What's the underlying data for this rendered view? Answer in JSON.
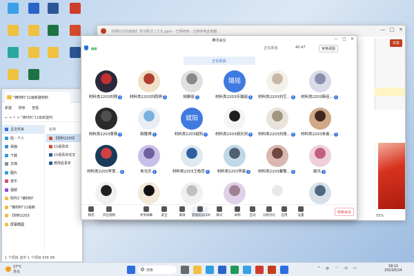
{
  "desktop": {
    "icons": [
      {
        "label": "",
        "color": "#3aa0e8"
      },
      {
        "label": "",
        "color": "#2b64c9"
      },
      {
        "label": "",
        "color": "#2b5797"
      },
      {
        "label": "",
        "color": "#d03c2c"
      },
      {
        "label": "",
        "color": "#f0c040"
      },
      {
        "label": "",
        "color": "#f0c040"
      },
      {
        "label": "",
        "color": "#1f7244"
      },
      {
        "label": "",
        "color": "#d44a2a"
      },
      {
        "label": "",
        "color": "#2aa8a0"
      },
      {
        "label": "",
        "color": "#f0c040"
      },
      {
        "label": "",
        "color": "#f0c040"
      },
      {
        "label": "",
        "color": "#2b5797"
      },
      {
        "label": "",
        "color": "#1f7244"
      },
      {
        "label": "",
        "color": "#f0c040"
      }
    ]
  },
  "ppt": {
    "title": "【材料2203班级】学习研讨二十大.pptx - 已保存到 - 已保存到此电脑",
    "share_label": "共享",
    "status_zoom": "55%"
  },
  "explorer": {
    "tab_title": "\"铸材料\"11级新建材料",
    "toolbar": [
      "新建",
      "排序",
      "查看"
    ],
    "nav_path": "> \"铸材料\"11级新建材",
    "sidebar": [
      {
        "label": "主文件夹",
        "color": "#2e6fe0"
      },
      {
        "label": "陆 - 个人",
        "color": "#2e9ae0"
      },
      {
        "label": "桌面",
        "color": "#3a8ad8"
      },
      {
        "label": "下载",
        "color": "#2e9ae0"
      },
      {
        "label": "文档",
        "color": "#7a8aa0"
      },
      {
        "label": "图片",
        "color": "#2ea0e0"
      },
      {
        "label": "音乐",
        "color": "#e04a6a"
      },
      {
        "label": "视频",
        "color": "#8a4ae0"
      },
      {
        "label": "附件2 \"铸材料\"",
        "color": "#f0c040"
      },
      {
        "label": "\"铸材料\"11级新",
        "color": "#f0c040"
      },
      {
        "label": "【材料2203",
        "color": "#f0c040"
      },
      {
        "label": "屏幕截图",
        "color": "#f0c040"
      }
    ],
    "column_header": "名称",
    "files": [
      {
        "name": "【材料2203】",
        "color": "#d44a2a"
      },
      {
        "name": "11组青年",
        "color": "#d44a2a"
      },
      {
        "name": "11组青年论文",
        "color": "#2b5797"
      },
      {
        "name": "修改后青年",
        "color": "#2b5797"
      }
    ],
    "status": "1 个项目   选中 1 个项目  936 KB"
  },
  "meeting": {
    "title": "腾讯会议",
    "time": "40:47",
    "speaker_label": "正在讲话:",
    "view_label": "宫格视图",
    "speaking_banner": "正在讲话:",
    "participants": [
      {
        "name": "材料类2203刘翔",
        "avatar_text": "",
        "c1": "#2a2a3a",
        "c2": "#c03030"
      },
      {
        "name": "材料类2203刘雨婷",
        "avatar_text": "",
        "c1": "#f0e0c8",
        "c2": "#b04030"
      },
      {
        "name": "胡雅丽",
        "avatar_text": "",
        "c1": "#e0e0e0",
        "c2": "#888888"
      },
      {
        "name": "材料类2203乐璐瑶",
        "avatar_text": "璐瑶",
        "c1": "#3f7ae0",
        "c2": "#3f7ae0"
      },
      {
        "name": "材料类2203刘艺...",
        "avatar_text": "",
        "c1": "#f4f0ea",
        "c2": "#c8b8a8"
      },
      {
        "name": "材料类2203韩佳...",
        "avatar_text": "",
        "c1": "#d8dce8",
        "c2": "#8890b0"
      },
      {
        "name": "材料类2203周晴",
        "avatar_text": "",
        "c1": "#2a2a2a",
        "c2": "#505050"
      },
      {
        "name": "韩敬博",
        "avatar_text": "",
        "c1": "#e8eef4",
        "c2": "#7ab0e0"
      },
      {
        "name": "材料类2203斌阳",
        "avatar_text": "斌阳",
        "c1": "#3f7ae0",
        "c2": "#3f7ae0"
      },
      {
        "name": "材料类2203胡天则",
        "avatar_text": "",
        "c1": "#f4f4f4",
        "c2": "#202020"
      },
      {
        "name": "材料类2203刘旭...",
        "avatar_text": "",
        "c1": "#e8e4dc",
        "c2": "#a09880"
      },
      {
        "name": "材料类2203朱俊...",
        "avatar_text": "",
        "c1": "#d0a888",
        "c2": "#402820"
      },
      {
        "name": "材料类2203李意...",
        "avatar_text": "",
        "c1": "#1a3a5a",
        "c2": "#d04040"
      },
      {
        "name": "朱光庆",
        "avatar_text": "",
        "c1": "#c8c0e8",
        "c2": "#7060a0"
      },
      {
        "name": "材料类2203王皓哲",
        "avatar_text": "",
        "c1": "#e0e8f0",
        "c2": "#3060a0"
      },
      {
        "name": "材料类2203李康",
        "avatar_text": "",
        "c1": "#c0d8e8",
        "c2": "#506070"
      },
      {
        "name": "材料类2203秦敬...",
        "avatar_text": "",
        "c1": "#d8b8b0",
        "c2": "#704840"
      },
      {
        "name": "颖光",
        "avatar_text": "",
        "c1": "#f0d0d8",
        "c2": "#c06080"
      },
      {
        "name": "",
        "avatar_text": "",
        "c1": "#f0f0f0",
        "c2": "#202020"
      },
      {
        "name": "",
        "avatar_text": "",
        "c1": "#f4e8d8",
        "c2": "#101010"
      },
      {
        "name": "",
        "avatar_text": "",
        "c1": "#f0f0f0",
        "c2": "#c0c0c0"
      },
      {
        "name": "",
        "avatar_text": "",
        "c1": "#e0d0e8",
        "c2": "#a08090"
      },
      {
        "name": "",
        "avatar_text": "",
        "c1": "#ffffff",
        "c2": "#e8e8e8"
      },
      {
        "name": "",
        "avatar_text": "",
        "c1": "#d8e0e8",
        "c2": "#506880"
      }
    ],
    "toolbar": [
      {
        "label": "静音",
        "active": false
      },
      {
        "label": "开启视频",
        "active": false
      },
      {
        "label": "共享屏幕",
        "active": false
      },
      {
        "label": "安全",
        "active": false
      },
      {
        "label": "邀请",
        "active": false
      },
      {
        "label": "管理成员(29)",
        "active": true
      },
      {
        "label": "聊天",
        "active": false
      },
      {
        "label": "录制",
        "active": false
      },
      {
        "label": "互动",
        "active": false
      },
      {
        "label": "分组讨论",
        "active": false
      },
      {
        "label": "应用",
        "active": false
      },
      {
        "label": "设置",
        "active": false
      }
    ],
    "end_label": "结束会议"
  },
  "taskbar": {
    "temp": "27°C",
    "weather": "多云",
    "search_placeholder": "搜索",
    "clock_time": "18:11",
    "clock_date": "2023/5/14",
    "lang": "中"
  }
}
